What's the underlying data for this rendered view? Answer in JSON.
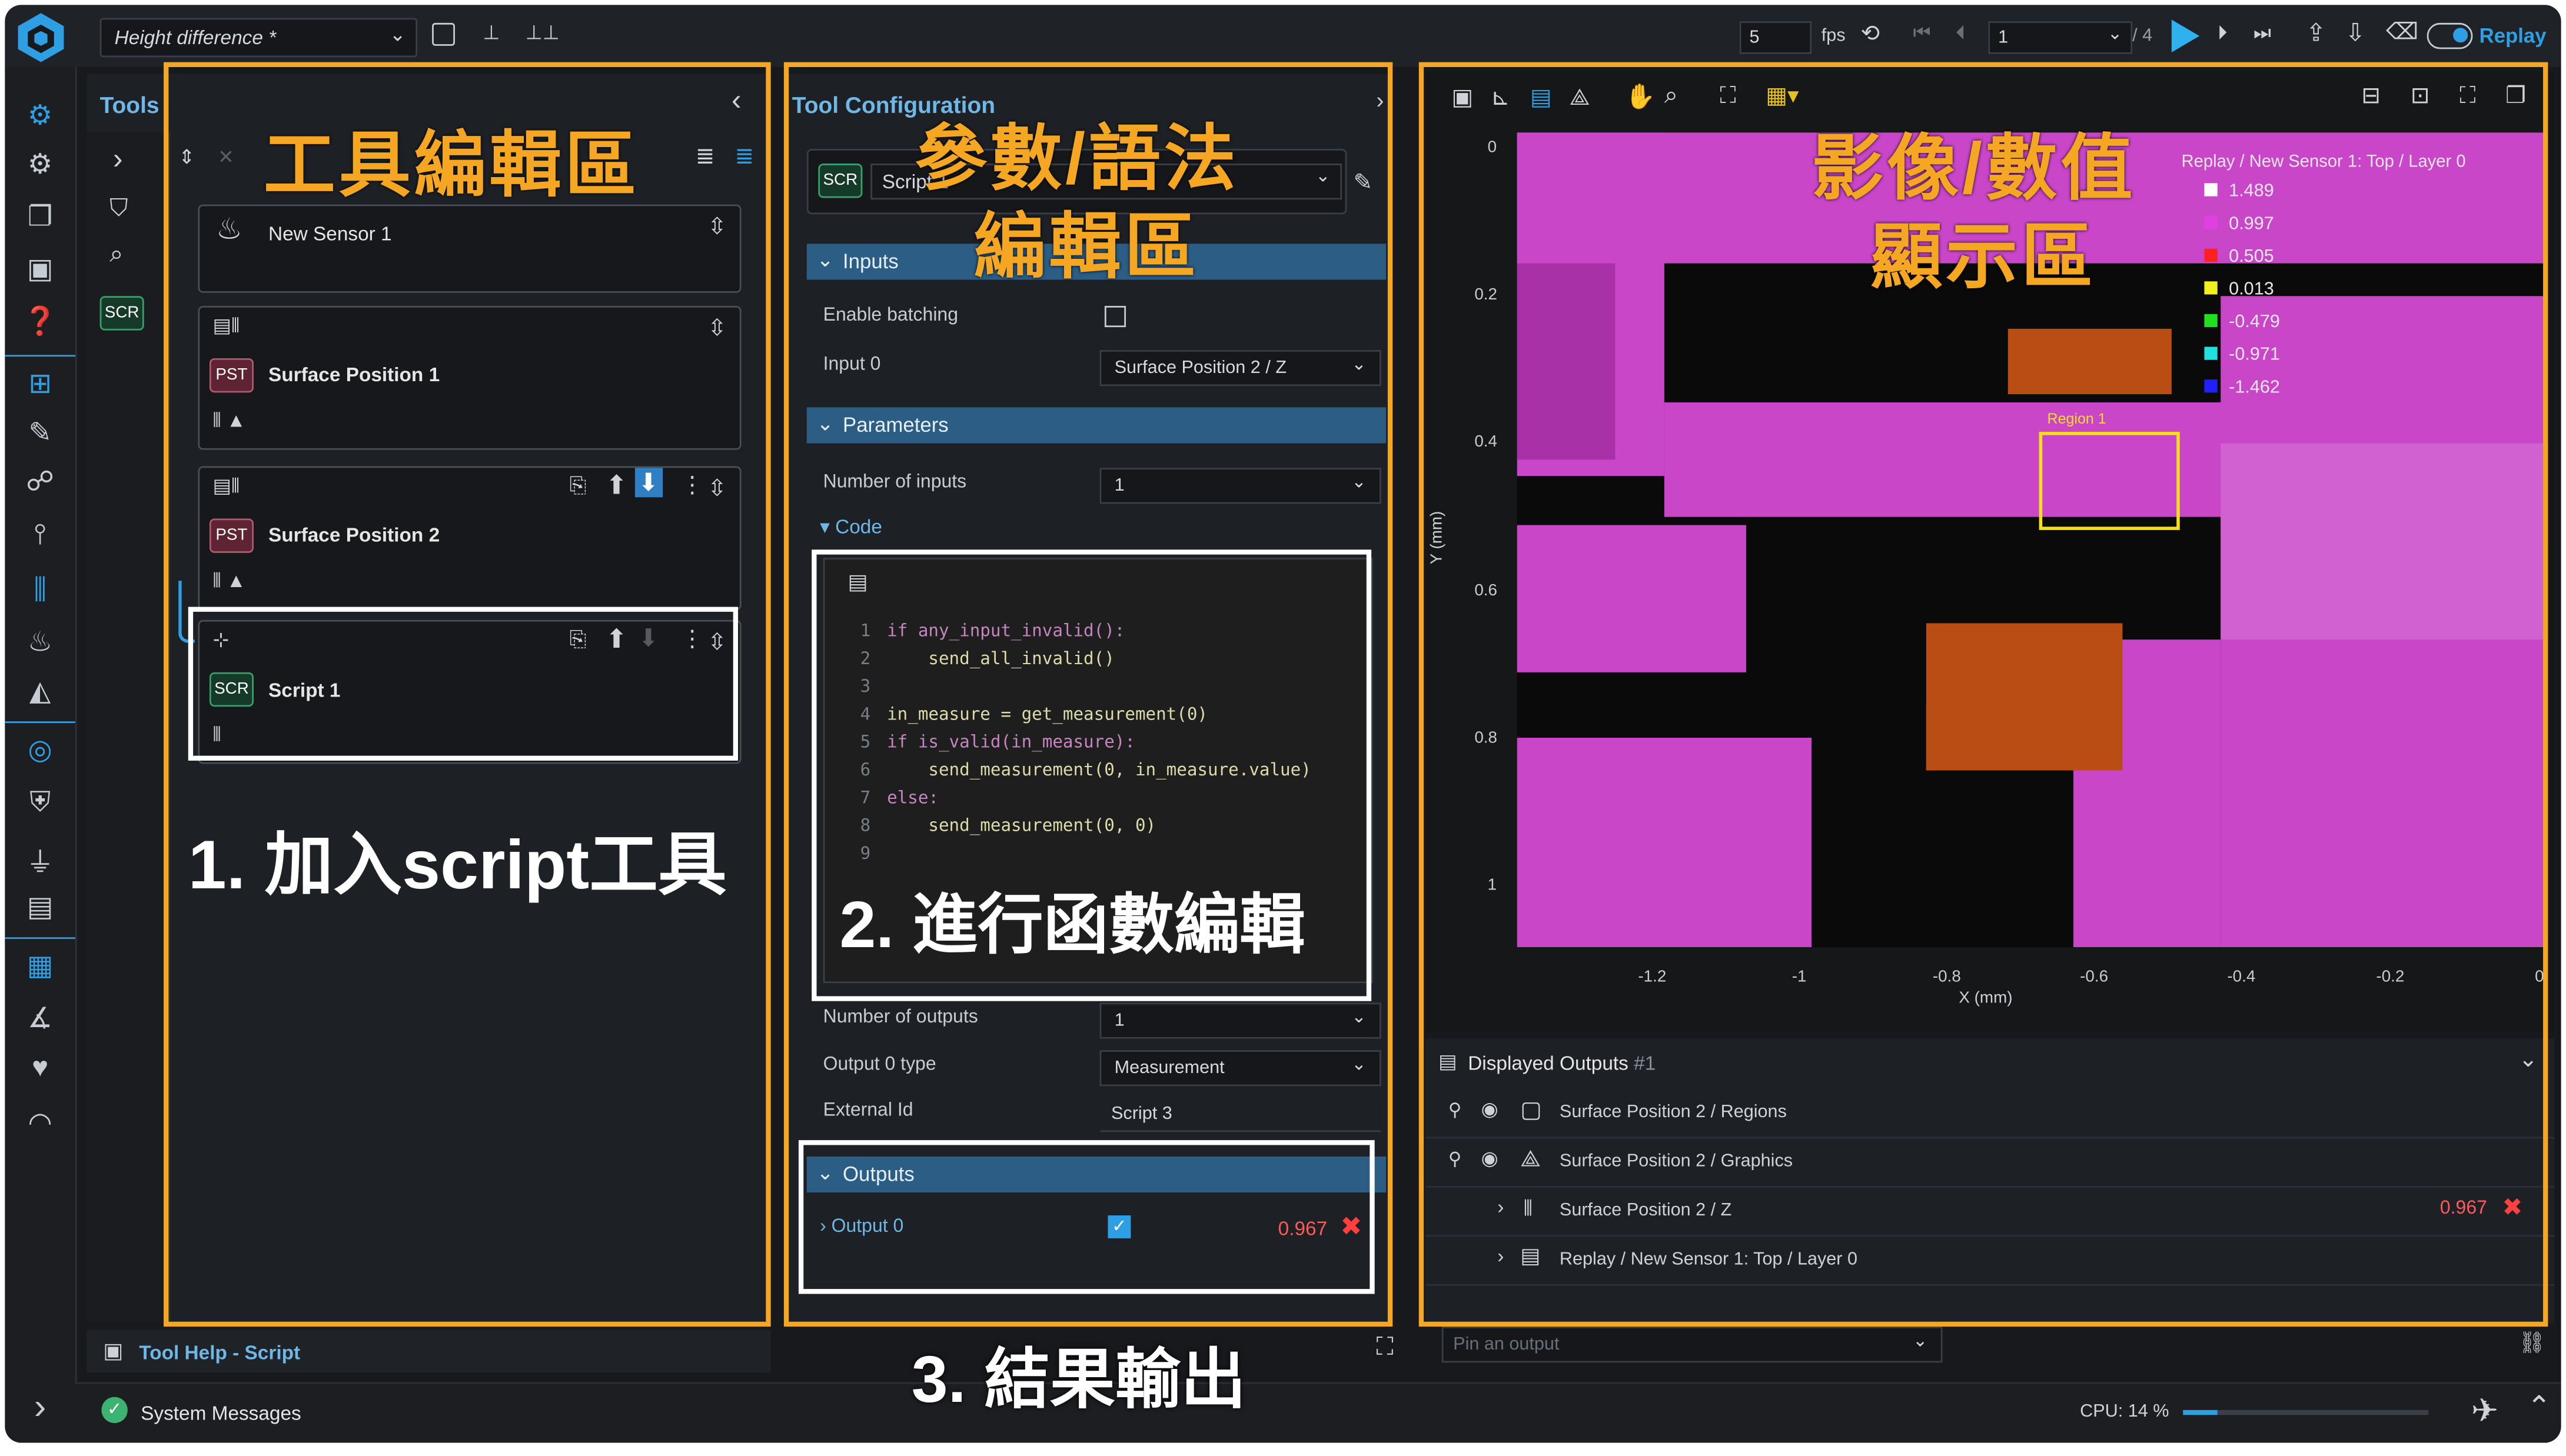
{
  "topbar": {
    "profile_dropdown": "Height difference *",
    "fps_value": "5",
    "fps_label": "fps",
    "frame_value": "1",
    "frame_total": "/ 4",
    "replay_label": "Replay"
  },
  "tools_panel": {
    "title": "Tools",
    "annotation": "工具編輯區",
    "tools": [
      {
        "name": "New Sensor 1"
      },
      {
        "badge": "PST",
        "name": "Surface Position 1"
      },
      {
        "badge": "PST",
        "name": "Surface Position 2"
      },
      {
        "badge": "SCR",
        "name": "Script 1"
      }
    ],
    "sidebar_badge": "SCR",
    "step1": "1. 加入script工具"
  },
  "config_panel": {
    "title": "Tool Configuration",
    "annotation_line1": "參數/語法",
    "annotation_line2": "編輯區",
    "tool_badge": "SCR",
    "tool_select": "Script 1",
    "inputs_header": "Inputs",
    "enable_batching_label": "Enable batching",
    "input0_label": "Input 0",
    "input0_value": "Surface Position 2 / Z",
    "parameters_header": "Parameters",
    "num_inputs_label": "Number of inputs",
    "num_inputs_value": "1",
    "code_label": "Code",
    "code_lines": [
      {
        "n": "1",
        "text": "if any_input_invalid():"
      },
      {
        "n": "2",
        "text": "    send_all_invalid()"
      },
      {
        "n": "3",
        "text": ""
      },
      {
        "n": "4",
        "text": "in_measure = get_measurement(0)"
      },
      {
        "n": "5",
        "text": "if is_valid(in_measure):"
      },
      {
        "n": "6",
        "text": "    send_measurement(0, in_measure.value)"
      },
      {
        "n": "7",
        "text": "else:"
      },
      {
        "n": "8",
        "text": "    send_measurement(0, 0)"
      },
      {
        "n": "9",
        "text": ""
      }
    ],
    "step2": "2. 進行函數編輯",
    "num_outputs_label": "Number of outputs",
    "num_outputs_value": "1",
    "output0_type_label": "Output 0 type",
    "output0_type_value": "Measurement",
    "external_id_label": "External Id",
    "external_id_value": "Script 3",
    "outputs_header": "Outputs",
    "output0_label": "Output 0",
    "output0_value": "0.967",
    "step3": "3. 結果輸出"
  },
  "viewer": {
    "annotation_line1": "影像/數值",
    "annotation_line2": "顯示區",
    "legend_title": "Replay / New Sensor 1: Top / Layer 0",
    "legend": [
      {
        "value": "1.489",
        "color": "#ffffff"
      },
      {
        "value": "0.997",
        "color": "#e040e0"
      },
      {
        "value": "0.505",
        "color": "#ff2020"
      },
      {
        "value": "0.013",
        "color": "#f0f020"
      },
      {
        "value": "-0.479",
        "color": "#20e020"
      },
      {
        "value": "-0.971",
        "color": "#20e0e0"
      },
      {
        "value": "-1.462",
        "color": "#2020ff"
      }
    ],
    "y_ticks": [
      "0",
      "0.2",
      "0.4",
      "0.6",
      "0.8",
      "1"
    ],
    "x_ticks": [
      "-1.2",
      "-1",
      "-0.8",
      "-0.6",
      "-0.4",
      "-0.2",
      "0"
    ],
    "y_label": "Y (mm)",
    "x_label": "X (mm)",
    "region_label": "Region 1"
  },
  "outputs_panel": {
    "title": "Displayed Outputs",
    "count": "#1",
    "rows": [
      {
        "name": "Surface Position 2 / Regions",
        "value": ""
      },
      {
        "name": "Surface Position 2 / Graphics",
        "value": ""
      },
      {
        "name": "Surface Position 2 / Z",
        "value": "0.967"
      },
      {
        "name": "Replay / New Sensor 1: Top / Layer 0",
        "value": ""
      }
    ],
    "pin_placeholder": "Pin an output"
  },
  "bottombar": {
    "tool_help": "Tool Help - Script",
    "system_messages": "System Messages",
    "cpu": "CPU: 14 %"
  }
}
